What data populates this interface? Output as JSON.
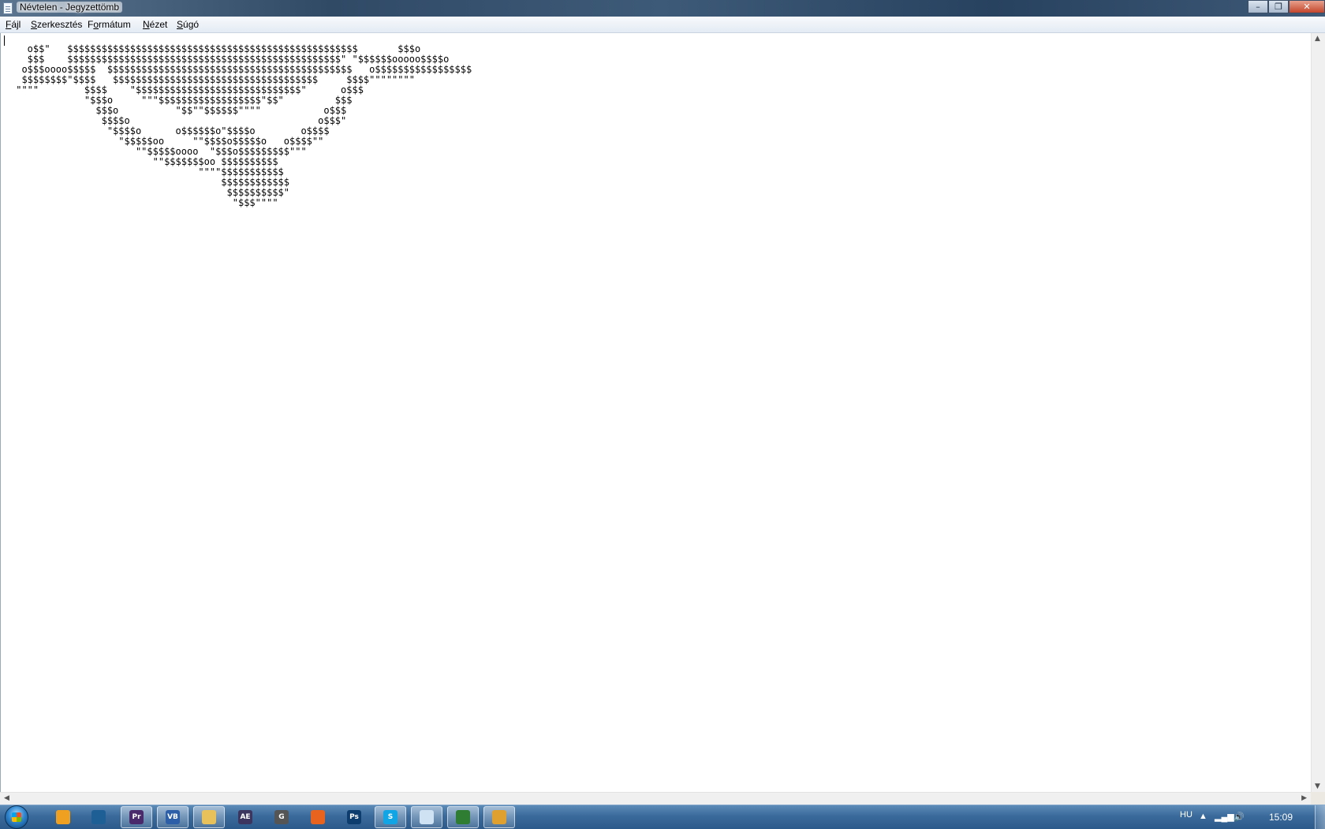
{
  "window": {
    "title": "Névtelen - Jegyzettömb",
    "minimize_glyph": "–",
    "maximize_glyph": "❐",
    "close_glyph": "✕"
  },
  "menu": {
    "file": {
      "acc": "F",
      "rest": "ájl"
    },
    "edit": {
      "acc": "S",
      "rest": "zerkesztés"
    },
    "format": {
      "pre": "F",
      "acc": "o",
      "rest": "rmátum"
    },
    "view": {
      "acc": "N",
      "rest": "ézet"
    },
    "help": {
      "acc": "S",
      "rest": "úgó"
    }
  },
  "editor": {
    "text": "   o$$\"   $$$$$$$$$$$$$$$$$$$$$$$$$$$$$$$$$$$$$$$$$$$$$$$$$$$       $$$o\n   $$$    $$$$$$$$$$$$$$$$$$$$$$$$$$$$$$$$$$$$$$$$$$$$$$$$\" \"$$$$$$ooooo$$$$o\n  o$$$oooo$$$$$  $$$$$$$$$$$$$$$$$$$$$$$$$$$$$$$$$$$$$$$$$$$   o$$$$$$$$$$$$$$$$$\n  $$$$$$$$\"$$$$   $$$$$$$$$$$$$$$$$$$$$$$$$$$$$$$$$$$$     $$$$\"\"\"\"\"\"\"\"\n \"\"\"\"        $$$$    \"$$$$$$$$$$$$$$$$$$$$$$$$$$$$$\"      o$$$\n             \"$$$o     \"\"\"$$$$$$$$$$$$$$$$$$\"$$\"         $$$\n               $$$o          \"$$\"\"$$$$$$\"\"\"\"           o$$$\n                $$$$o                                 o$$$\"\n                 \"$$$$o      o$$$$$$o\"$$$$o        o$$$$\n                   \"$$$$$oo     \"\"$$$$o$$$$$o   o$$$$\"\"\n                      \"\"$$$$$oooo  \"$$$o$$$$$$$$$\"\"\"\n                         \"\"$$$$$$$oo $$$$$$$$$$\n                                 \"\"\"\"$$$$$$$$$$$\n                                     $$$$$$$$$$$$\n                                      $$$$$$$$$$\"\n                                       \"$$$\"\"\"\""
  },
  "taskbar": {
    "apps": [
      {
        "name": "media-player-icon",
        "label": "",
        "color": "#f0a020"
      },
      {
        "name": "globe-app-icon",
        "label": "",
        "color": "#1e5f96"
      },
      {
        "name": "premiere-icon",
        "label": "Pr",
        "color": "#4b2a6b"
      },
      {
        "name": "vb-app-icon",
        "label": "VB",
        "color": "#2d5fa8"
      },
      {
        "name": "explorer-folder-icon",
        "label": "",
        "color": "#e8c15a"
      },
      {
        "name": "after-effects-icon",
        "label": "AE",
        "color": "#3b3560"
      },
      {
        "name": "g-app-icon",
        "label": "G",
        "color": "#555555"
      },
      {
        "name": "firefox-icon",
        "label": "",
        "color": "#e8641e"
      },
      {
        "name": "photoshop-icon",
        "label": "Ps",
        "color": "#0d3c6e"
      },
      {
        "name": "skype-icon",
        "label": "S",
        "color": "#12a5e5"
      },
      {
        "name": "notepad-icon",
        "label": "",
        "color": "#cfe2f3"
      },
      {
        "name": "task-manager-icon",
        "label": "",
        "color": "#2e7d32"
      },
      {
        "name": "app-window-icon",
        "label": "",
        "color": "#e0a030"
      }
    ],
    "tray": {
      "language": "HU",
      "up_arrow": "▲",
      "network": "▂▄▆",
      "volume": "🔊",
      "clock": "15:09"
    }
  }
}
